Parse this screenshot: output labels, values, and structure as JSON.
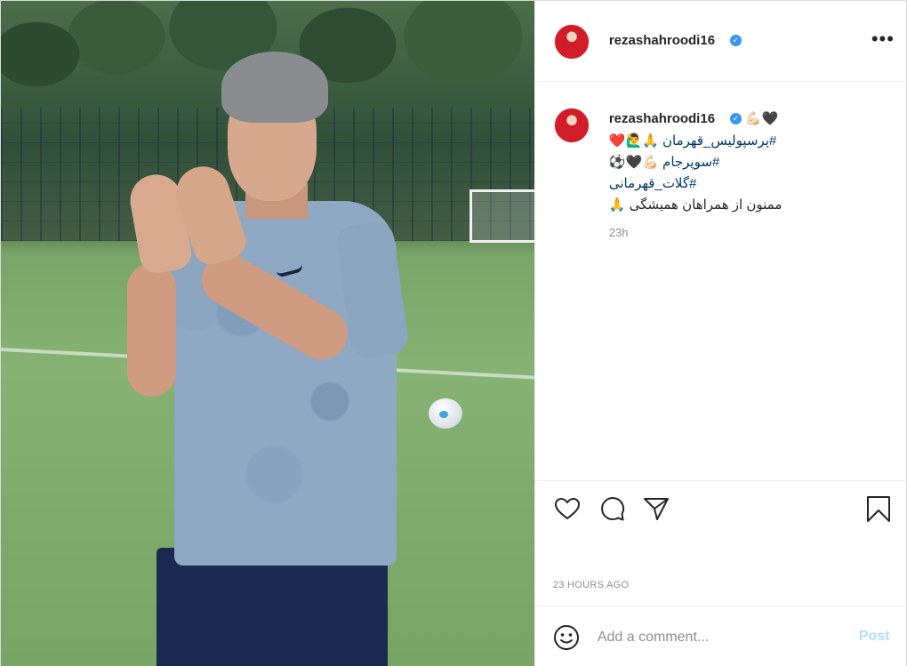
{
  "post": {
    "username": "rezashahroodi16",
    "verified_mark": "✓",
    "more_label": "•••"
  },
  "caption": {
    "emoji_line": "💪🏻🖤",
    "line1": "#پرسپولیس_قهرمان 🙏🙋‍♂️❤️",
    "line2": "#سوپرجام 💪🏻🖤⚽",
    "line3": "#گلات_قهرمانی",
    "line4": "ممنون از همراهان همیشگی 🙏",
    "time": "23h"
  },
  "date_label": "23 HOURS AGO",
  "comment": {
    "placeholder": "Add a comment...",
    "post_label": "Post"
  },
  "colors": {
    "verified": "#3897f0",
    "post_disabled": "#b2dffc",
    "muted": "#8e8e8e"
  },
  "icons": [
    "heart-icon",
    "comment-icon",
    "share-icon",
    "bookmark-icon",
    "emoji-icon",
    "more-icon"
  ]
}
